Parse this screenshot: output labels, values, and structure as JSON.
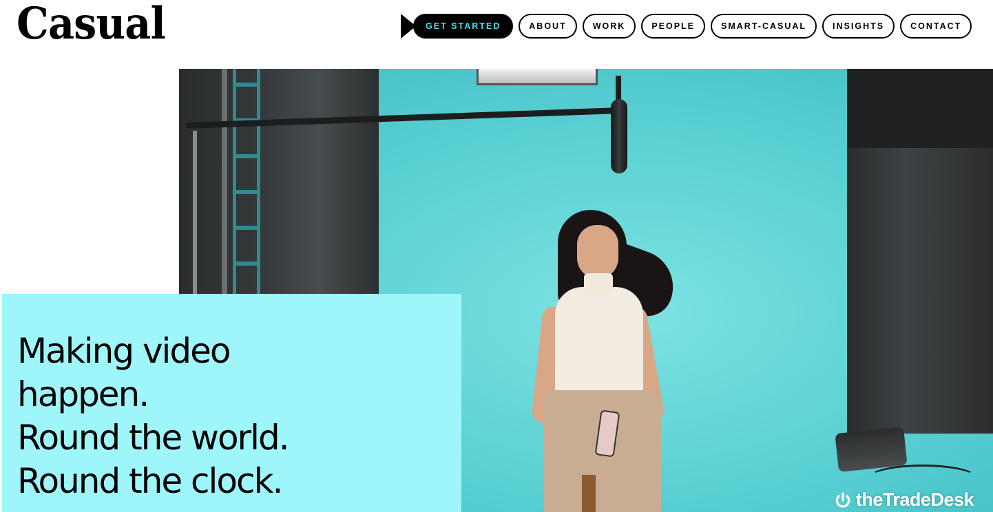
{
  "brand": {
    "logo_text": "Casual"
  },
  "nav": {
    "items": [
      {
        "label": "GET STARTED",
        "primary": true
      },
      {
        "label": "ABOUT"
      },
      {
        "label": "WORK"
      },
      {
        "label": "PEOPLE"
      },
      {
        "label": "SMART-CASUAL"
      },
      {
        "label": "INSIGHTS"
      },
      {
        "label": "CONTACT"
      }
    ]
  },
  "hero": {
    "headline_lines": [
      "Making video",
      "happen.",
      "Round the world.",
      "Round the clock."
    ],
    "watermark": "theTradeDesk",
    "watermark_icon": "power-icon"
  },
  "colors": {
    "accent_cyan": "#45e3f3",
    "headline_box": "#9ef6fa",
    "backdrop": "#5ed3d6"
  }
}
